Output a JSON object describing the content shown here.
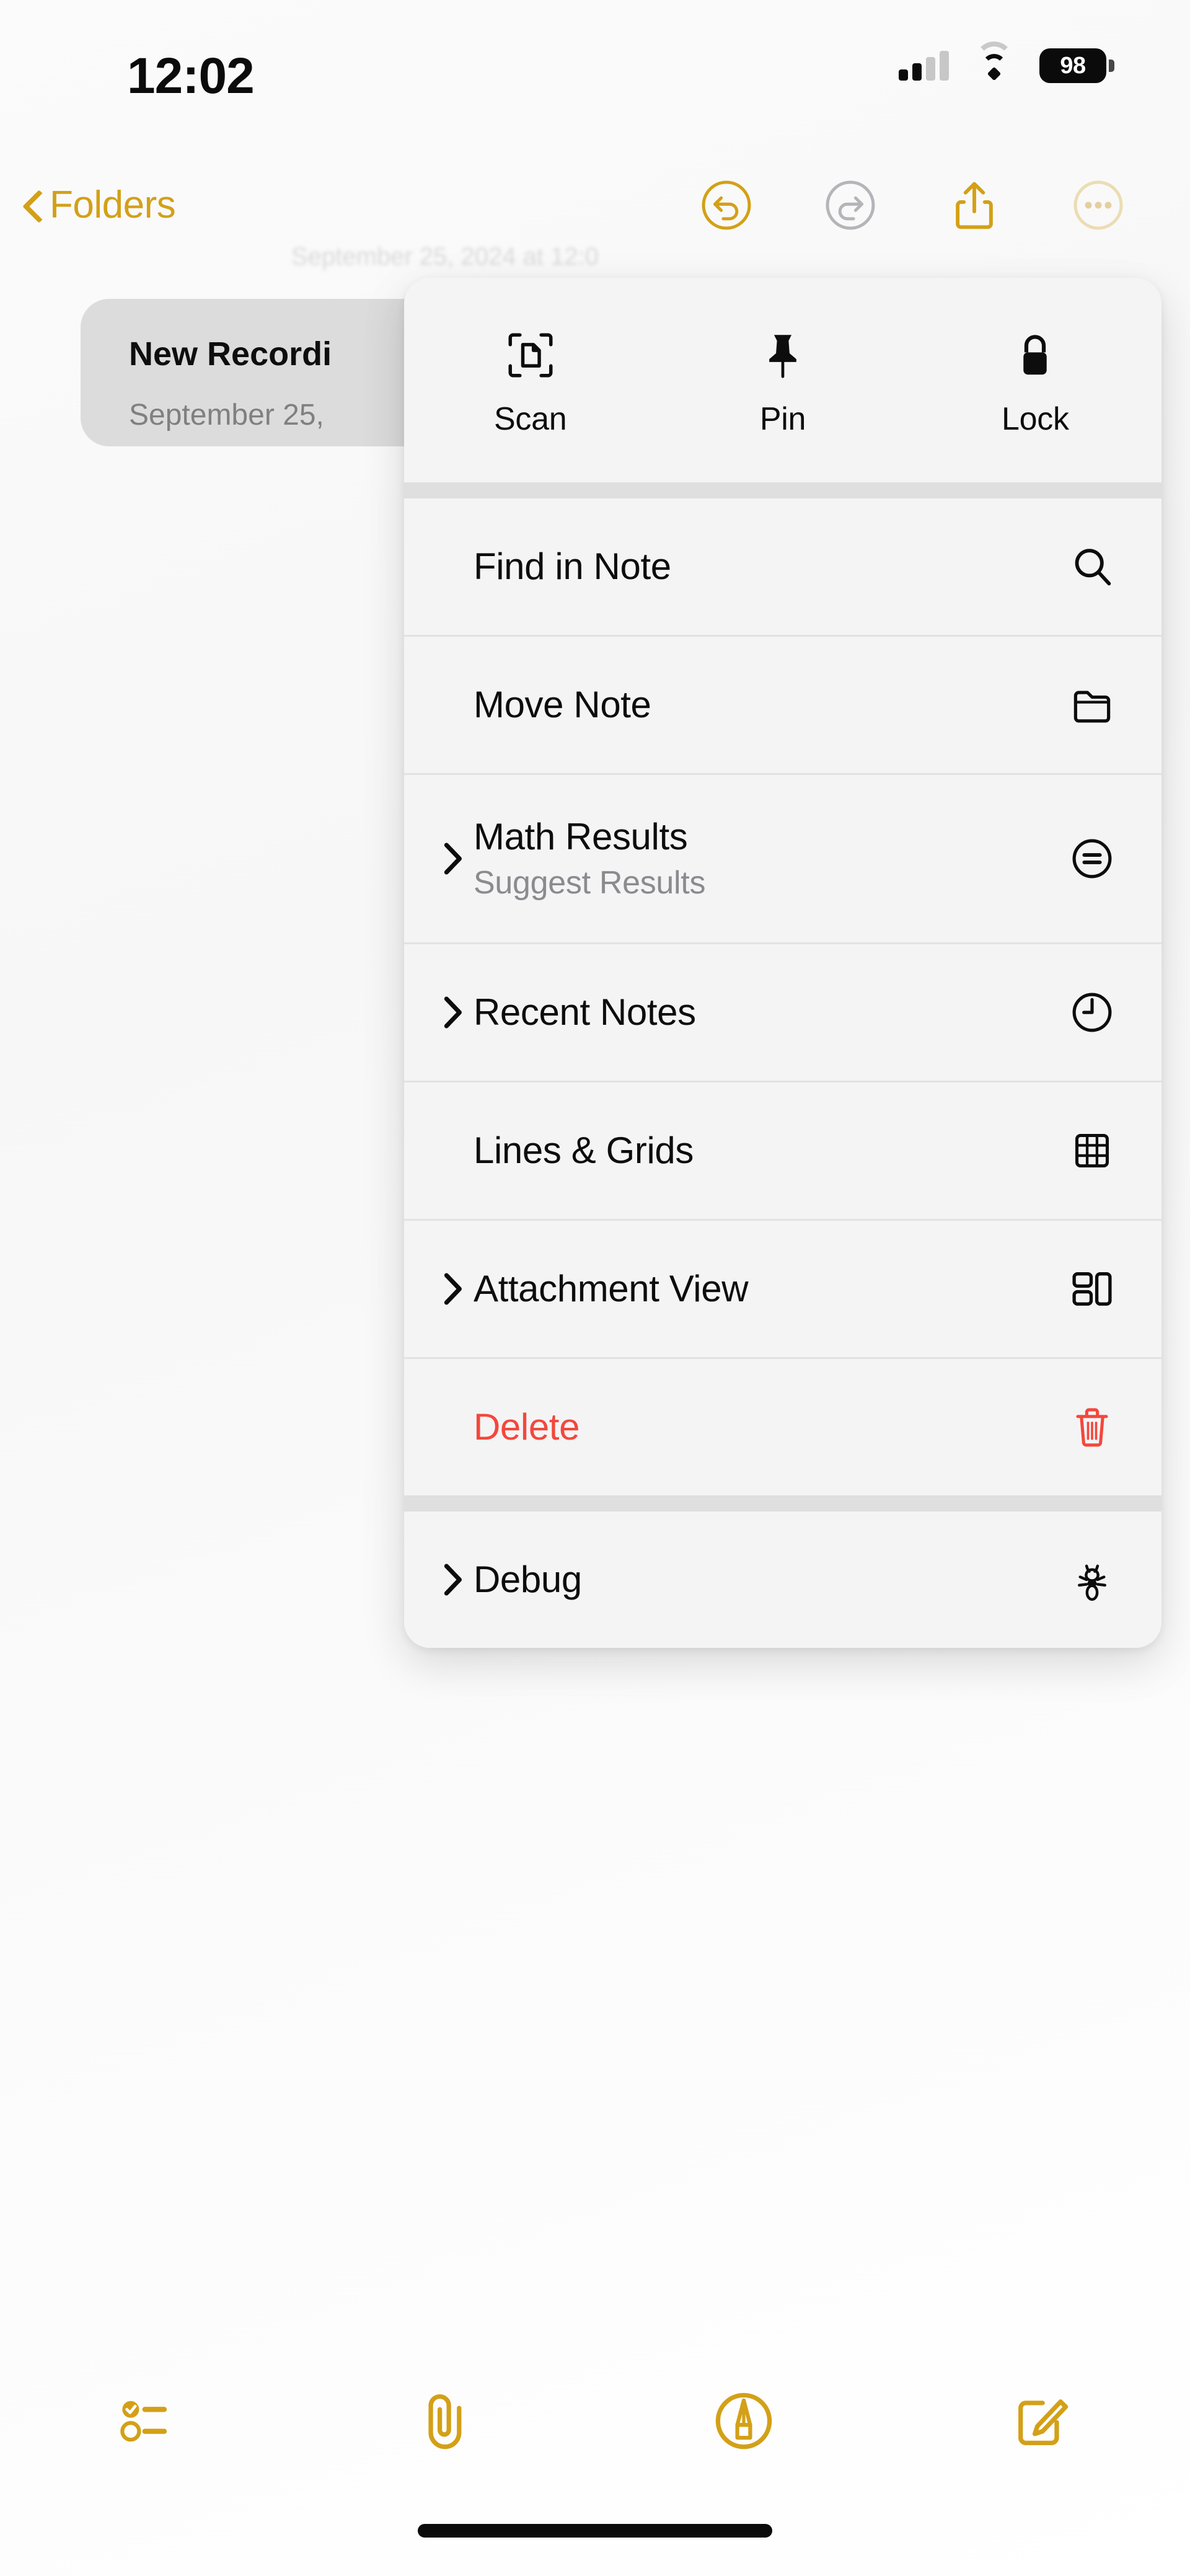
{
  "status_bar": {
    "time": "12:02",
    "battery_percent": "98",
    "signal_icon": "cellular-bars-icon",
    "wifi_icon": "wifi-icon",
    "battery_icon": "battery-icon"
  },
  "nav_bar": {
    "back_label": "Folders",
    "back_icon": "chevron-left-icon",
    "actions": [
      {
        "name": "undo-button",
        "icon": "undo-circle-icon",
        "enabled": true
      },
      {
        "name": "redo-button",
        "icon": "redo-circle-icon",
        "enabled": false
      },
      {
        "name": "share-button",
        "icon": "share-up-icon",
        "enabled": true
      },
      {
        "name": "more-button",
        "icon": "ellipsis-circle-icon",
        "enabled": true
      }
    ]
  },
  "note_list": {
    "background_date": "September 25, 2024 at 12:0",
    "row": {
      "title": "New Recordi",
      "subtitle": "September 25,"
    }
  },
  "context_menu": {
    "quick_actions": [
      {
        "label": "Scan",
        "icon": "scan-document-icon"
      },
      {
        "label": "Pin",
        "icon": "pin-icon"
      },
      {
        "label": "Lock",
        "icon": "lock-icon"
      }
    ],
    "items": [
      {
        "label": "Find in Note",
        "sublabel": "",
        "icon": "search-icon",
        "chevron": false,
        "danger": false
      },
      {
        "label": "Move Note",
        "sublabel": "",
        "icon": "folder-icon",
        "chevron": false,
        "danger": false
      },
      {
        "label": "Math Results",
        "sublabel": "Suggest Results",
        "icon": "equals-circle-icon",
        "chevron": true,
        "danger": false
      },
      {
        "label": "Recent Notes",
        "sublabel": "",
        "icon": "clock-icon",
        "chevron": true,
        "danger": false
      },
      {
        "label": "Lines & Grids",
        "sublabel": "",
        "icon": "grid-icon",
        "chevron": false,
        "danger": false
      },
      {
        "label": "Attachment View",
        "sublabel": "",
        "icon": "layout-tiles-icon",
        "chevron": true,
        "danger": false
      },
      {
        "label": "Delete",
        "sublabel": "",
        "icon": "trash-icon",
        "chevron": false,
        "danger": true
      }
    ],
    "footer_items": [
      {
        "label": "Debug",
        "sublabel": "",
        "icon": "bug-icon",
        "chevron": true,
        "danger": false
      }
    ]
  },
  "bottom_toolbar": [
    {
      "name": "checklist-button",
      "icon": "checklist-icon"
    },
    {
      "name": "attachment-button",
      "icon": "paperclip-icon"
    },
    {
      "name": "markup-button",
      "icon": "markup-pen-circle-icon"
    },
    {
      "name": "compose-button",
      "icon": "compose-square-pencil-icon"
    }
  ],
  "colors": {
    "accent": "#d3a017",
    "accent_disabled": "#b5b5b9",
    "accent_faded": "#ecdcb3",
    "danger": "#f4473c",
    "menu_bg": "#f4f4f5",
    "separator": "#dfdfe0",
    "text_primary": "#0d0d0d",
    "text_secondary": "#8b8b8f"
  },
  "home_indicator": {
    "name": "home-indicator"
  }
}
